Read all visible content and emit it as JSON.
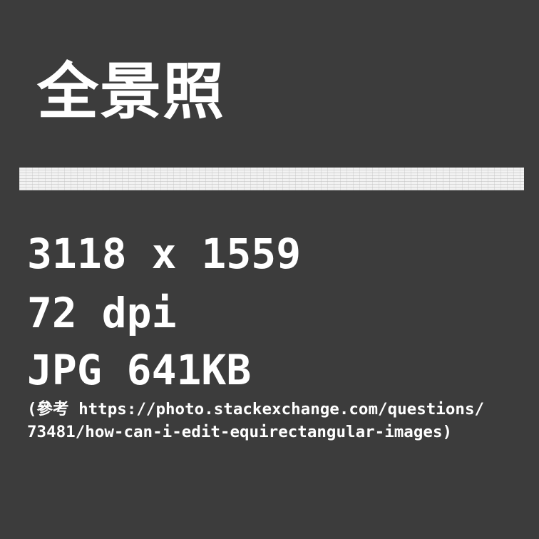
{
  "title": "全景照",
  "dimensions": "3118 x 1559",
  "resolution": "72 dpi",
  "file_info": "JPG 641KB",
  "reference": {
    "line1": "(參考 https://photo.stackexchange.com/questions/",
    "line2": "73481/how-can-i-edit-equirectangular-images)"
  },
  "colors": {
    "background": "#3c3c3c",
    "text": "#ffffff",
    "divider_bar": "#f2f2f2"
  }
}
